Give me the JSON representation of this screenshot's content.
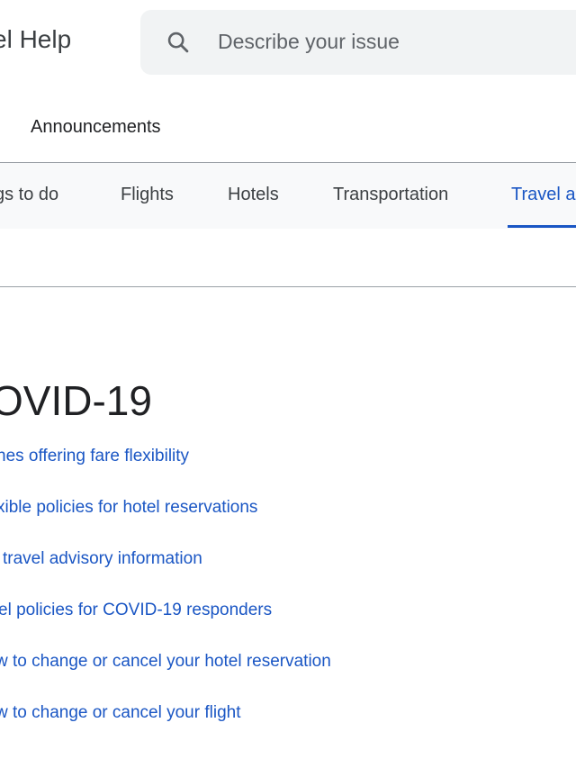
{
  "header": {
    "title": "el Help",
    "search_placeholder": "Describe your issue",
    "search_icon": "search-icon"
  },
  "tabs": {
    "announcements": "Announcements"
  },
  "categories": [
    {
      "label": "gs to do",
      "active": false
    },
    {
      "label": "Flights",
      "active": false
    },
    {
      "label": "Hotels",
      "active": false
    },
    {
      "label": "Transportation",
      "active": false
    },
    {
      "label": "Travel a",
      "active": true
    }
  ],
  "section": {
    "title": "OVID-19",
    "links": [
      "nes offering fare flexibility",
      "xible policies for hotel reservations",
      "travel advisory information",
      "el policies for COVID-19 responders",
      "w to change or cancel your hotel reservation",
      "w to change or cancel your flight"
    ]
  },
  "colors": {
    "accent": "#1a56c4",
    "search_bg": "#f1f3f4",
    "nav_bg": "#f8f9fa",
    "text": "#202124"
  }
}
